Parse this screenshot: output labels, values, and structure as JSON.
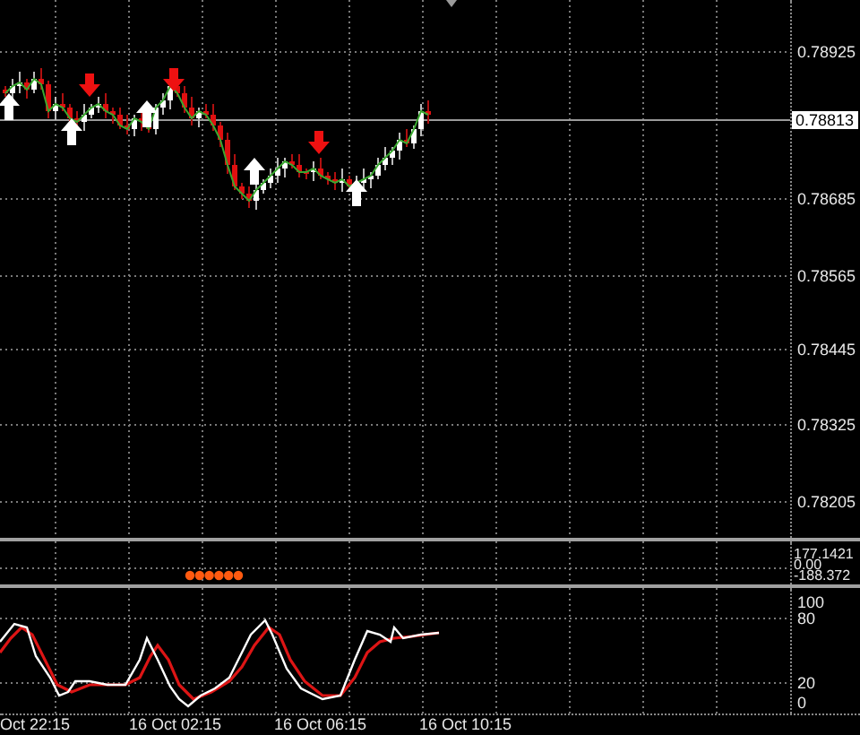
{
  "price_axis": {
    "labels": [
      "0.78925",
      "0.78685",
      "0.78565",
      "0.78445",
      "0.78325",
      "0.78205"
    ],
    "current_price": "0.78813"
  },
  "indicator_axis": {
    "labels": [
      "177.1421",
      "0.00",
      "-188.372"
    ]
  },
  "stochastic_axis": {
    "labels": [
      "100",
      "80",
      "20",
      "0"
    ]
  },
  "time_axis": {
    "labels": [
      "Oct 22:15",
      "16 Oct 02:15",
      "16 Oct 06:15",
      "16 Oct 10:15"
    ]
  }
}
